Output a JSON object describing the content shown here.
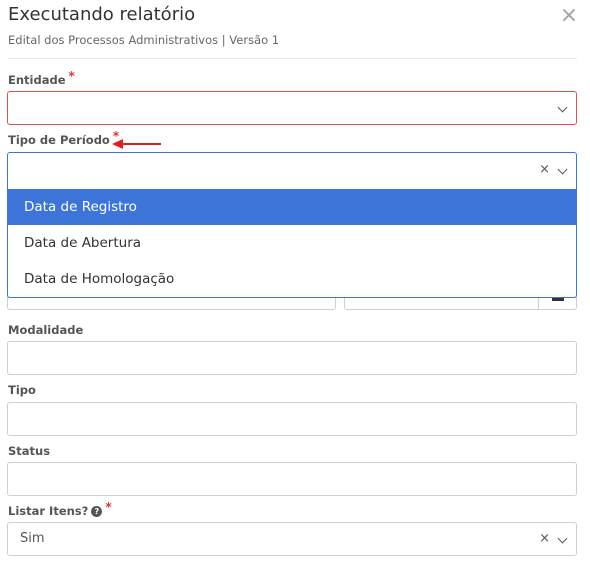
{
  "header": {
    "title": "Executando relatório",
    "subtitle": "Edital dos Processos Administrativos | Versão 1",
    "close_icon": "×"
  },
  "fields": {
    "entidade": {
      "label": "Entidade",
      "required": "*",
      "value": ""
    },
    "tipo_periodo": {
      "label": "Tipo de Período",
      "required": "*",
      "value": "",
      "clear_icon": "×",
      "options": [
        "Data de Registro",
        "Data de Abertura",
        "Data de Homologação"
      ],
      "highlighted_option": "Data de Registro"
    },
    "modalidade": {
      "label": "Modalidade",
      "value": ""
    },
    "tipo": {
      "label": "Tipo",
      "value": ""
    },
    "status": {
      "label": "Status",
      "value": ""
    },
    "listar_itens": {
      "label": "Listar Itens?",
      "required": "*",
      "help_icon": "?",
      "value": "Sim",
      "clear_icon": "×"
    }
  },
  "colors": {
    "accent": "#3c74d8",
    "error": "#d9534f",
    "required": "#e03131"
  }
}
